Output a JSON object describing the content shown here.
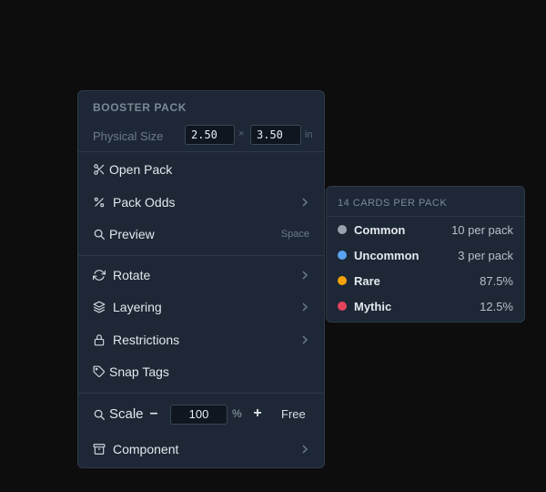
{
  "menu": {
    "header": "BOOSTER PACK",
    "physical_size": {
      "label": "Physical Size",
      "width": "2.50",
      "height": "3.50",
      "separator": "×",
      "unit": "in"
    },
    "items": [
      {
        "label": "Open Pack",
        "icon": "scissors-icon"
      },
      {
        "label": "Pack Odds",
        "icon": "percent-icon"
      },
      {
        "label": "Preview",
        "icon": "search-icon",
        "shortcut": "Space"
      },
      {
        "label": "Rotate",
        "icon": "rotate-icon"
      },
      {
        "label": "Layering",
        "icon": "layers-icon"
      },
      {
        "label": "Restrictions",
        "icon": "lock-icon"
      },
      {
        "label": "Snap Tags",
        "icon": "tag-icon"
      },
      {
        "label": "Component",
        "icon": "archive-icon"
      }
    ],
    "scale": {
      "label": "Scale",
      "icon": "search-icon",
      "value": "100",
      "unit": "%",
      "minus": "–",
      "plus": "+",
      "free_label": "Free"
    }
  },
  "odds": {
    "header": "14 CARDS PER PACK",
    "rows": [
      {
        "name": "Common",
        "value": "10 per pack",
        "color": "#9aa3ad"
      },
      {
        "name": "Uncommon",
        "value": "3 per pack",
        "color": "#5aa3f0"
      },
      {
        "name": "Rare",
        "value": "87.5%",
        "color": "#f5a20a"
      },
      {
        "name": "Mythic",
        "value": "12.5%",
        "color": "#e5435d"
      }
    ]
  }
}
